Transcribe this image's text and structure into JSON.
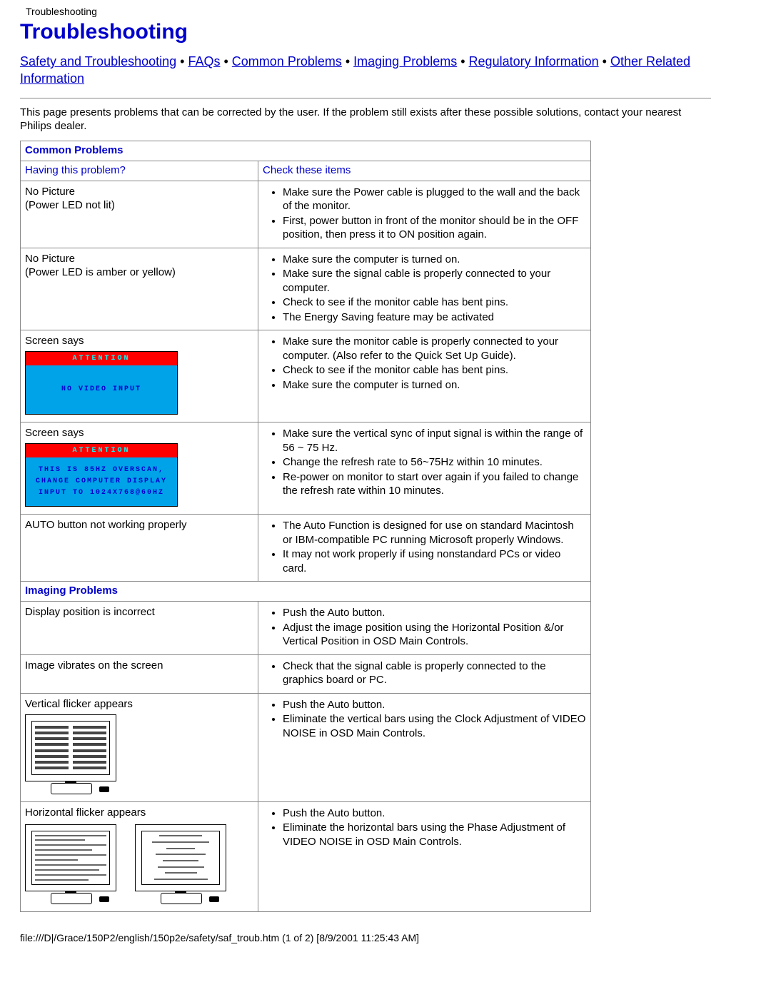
{
  "page_path": "Troubleshooting",
  "title": "Troubleshooting",
  "nav": {
    "links": [
      "Safety and Troubleshooting",
      "FAQs",
      "Common Problems",
      "Imaging Problems",
      "Regulatory Information",
      "Other Related Information"
    ],
    "separator": " • "
  },
  "intro": "This page presents problems that can be corrected by the user. If the problem still exists after these possible solutions, contact your nearest Philips dealer.",
  "sections": {
    "common": {
      "header": "Common Problems",
      "col_problem": "Having this problem?",
      "col_check": "Check these items",
      "rows": [
        {
          "problem_lines": [
            "No Picture",
            "(Power LED not lit)"
          ],
          "checks": [
            "Make sure the Power cable is plugged to the wall and the back of the monitor.",
            "First, power button in front of the monitor should be in the OFF position, then press it to ON position again."
          ]
        },
        {
          "problem_lines": [
            "No Picture",
            "(Power LED is amber or yellow)"
          ],
          "checks": [
            "Make sure the computer is turned on.",
            "Make sure the signal cable is properly connected to your computer.",
            "Check to see if the monitor cable has bent pins.",
            "The Energy Saving feature may be activated"
          ]
        },
        {
          "problem_lines": [
            "Screen says"
          ],
          "monitor_msg": {
            "header": "ATTENTION",
            "body_lines": [
              "NO VIDEO INPUT"
            ]
          },
          "checks": [
            "Make sure the monitor cable is properly connected to your computer. (Also refer to the Quick Set Up Guide).",
            "Check to see if the monitor cable has bent pins.",
            "Make sure the computer is turned on."
          ]
        },
        {
          "problem_lines": [
            "Screen says"
          ],
          "monitor_msg": {
            "header": "ATTENTION",
            "body_lines": [
              "THIS IS 85HZ OVERSCAN,",
              "CHANGE COMPUTER DISPLAY",
              "INPUT TO 1024X768@60HZ"
            ]
          },
          "checks": [
            "Make sure the vertical sync of input signal is within the range of 56 ~ 75 Hz.",
            "Change the refresh rate to 56~75Hz within 10 minutes.",
            "Re-power on monitor to start over again if you failed to change the refresh rate within 10 minutes."
          ]
        },
        {
          "problem_lines": [
            "AUTO button not working properly"
          ],
          "checks": [
            "The Auto Function is designed for use on standard Macintosh or IBM-compatible PC running Microsoft properly Windows.",
            "It may not work properly if using nonstandard PCs or video card."
          ]
        }
      ]
    },
    "imaging": {
      "header": "Imaging Problems",
      "rows": [
        {
          "problem_lines": [
            "Display position is incorrect"
          ],
          "checks": [
            "Push the Auto button.",
            "Adjust the image position using the Horizontal Position &/or Vertical Position in OSD Main Controls."
          ]
        },
        {
          "problem_lines": [
            "Image vibrates on the screen"
          ],
          "checks": [
            "Check that the signal cable is properly connected to the graphics board or PC."
          ]
        },
        {
          "problem_lines": [
            "Vertical flicker appears"
          ],
          "illustration": "vertical",
          "checks": [
            "Push the Auto button.",
            "Eliminate the vertical bars using the Clock Adjustment of VIDEO NOISE in OSD Main Controls."
          ]
        },
        {
          "problem_lines": [
            "Horizontal flicker appears"
          ],
          "illustration": "horizontal",
          "checks": [
            "Push the Auto button.",
            "Eliminate the horizontal bars using the Phase Adjustment of VIDEO NOISE in OSD Main Controls."
          ]
        }
      ]
    }
  },
  "footer": "file:///D|/Grace/150P2/english/150p2e/safety/saf_troub.htm (1 of 2) [8/9/2001 11:25:43 AM]"
}
